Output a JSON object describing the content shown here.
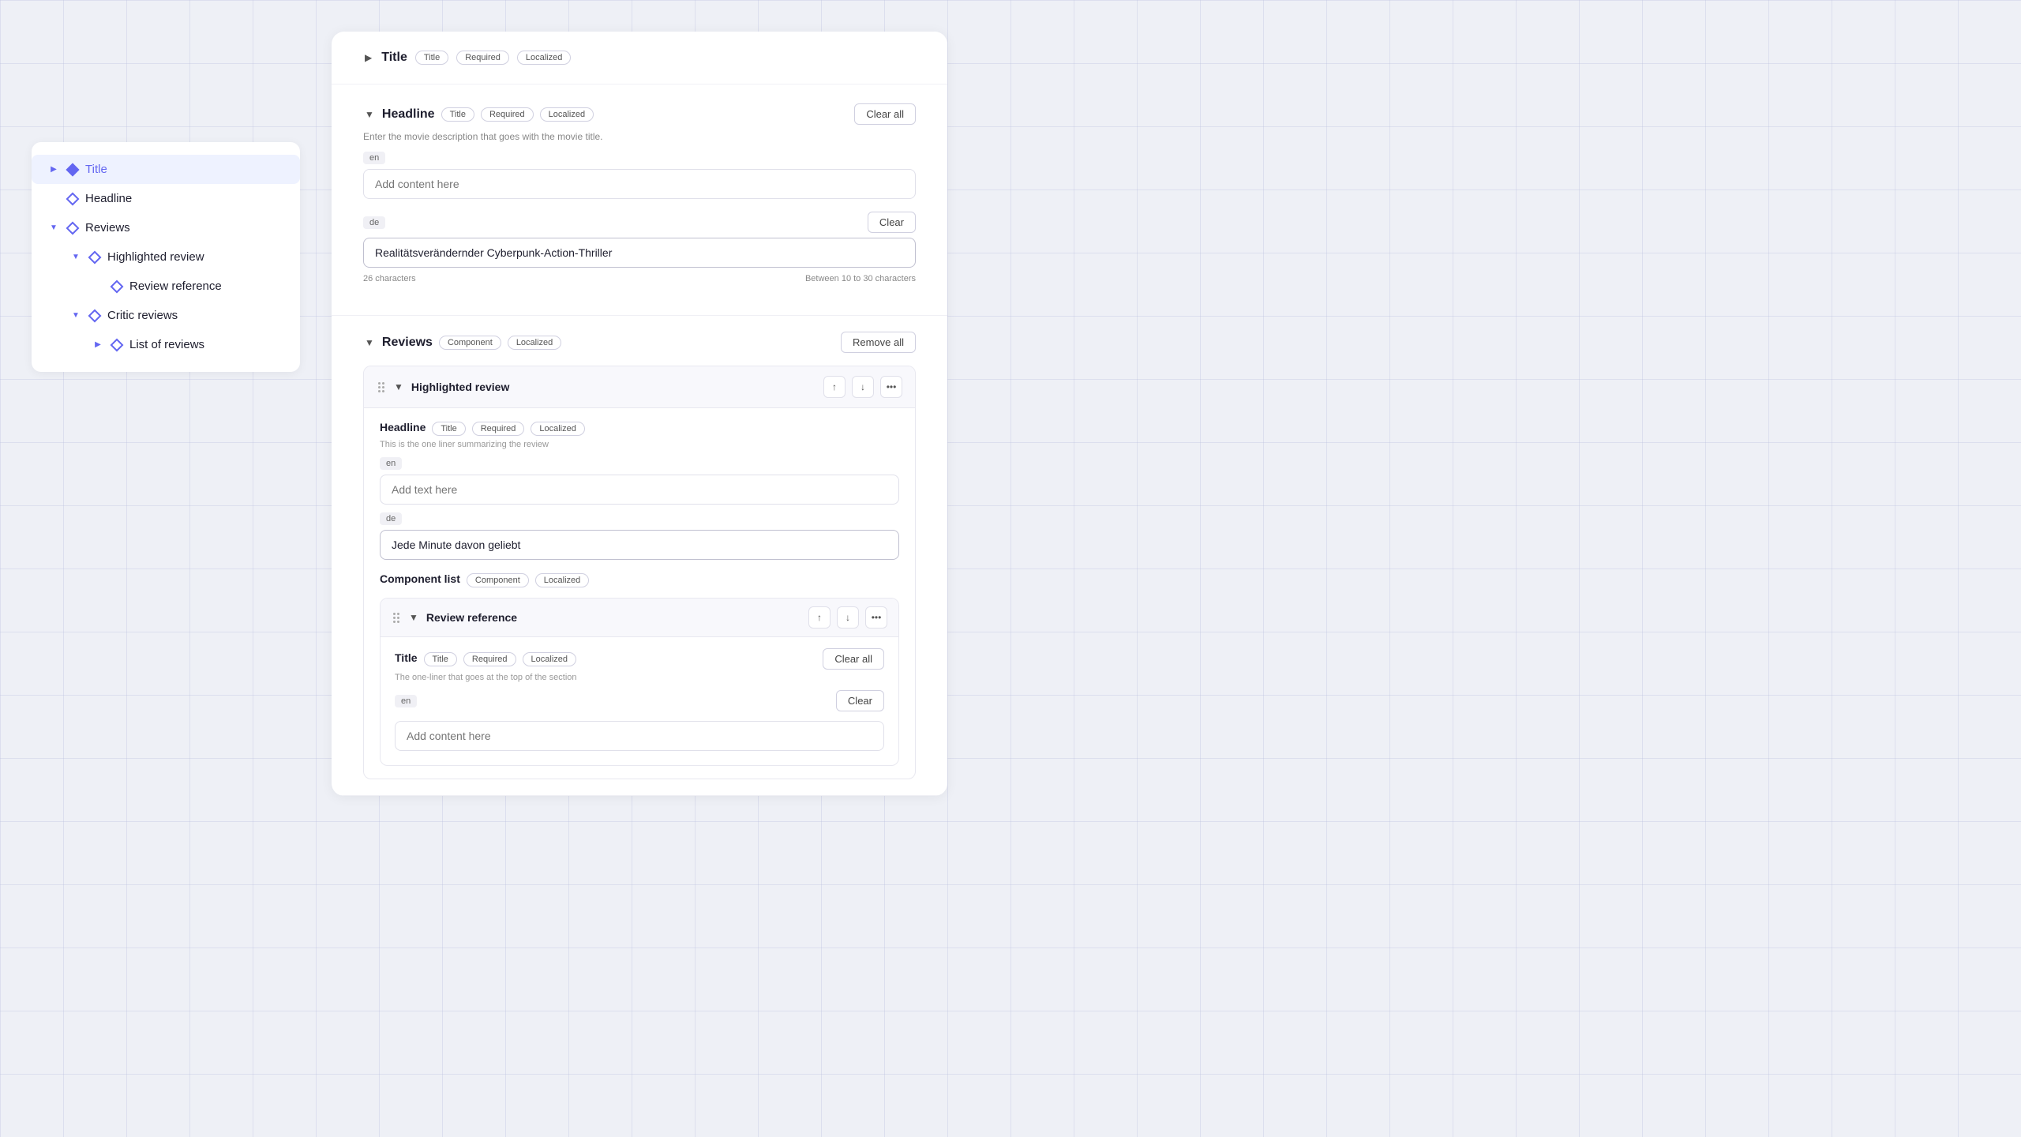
{
  "sidebar": {
    "items": [
      {
        "id": "title",
        "label": "Title",
        "indent": 0,
        "chevron": "right",
        "active": true,
        "diamond": "filled"
      },
      {
        "id": "headline",
        "label": "Headline",
        "indent": 0,
        "chevron": null,
        "active": false,
        "diamond": "outline"
      },
      {
        "id": "reviews",
        "label": "Reviews",
        "indent": 0,
        "chevron": "down",
        "active": false,
        "diamond": "outline"
      },
      {
        "id": "highlighted-review",
        "label": "Highlighted review",
        "indent": 1,
        "chevron": "down",
        "active": false,
        "diamond": "outline"
      },
      {
        "id": "review-reference",
        "label": "Review reference",
        "indent": 2,
        "chevron": null,
        "active": false,
        "diamond": "outline"
      },
      {
        "id": "critic-reviews",
        "label": "Critic reviews",
        "indent": 1,
        "chevron": "down",
        "active": false,
        "diamond": "outline"
      },
      {
        "id": "list-of-reviews",
        "label": "List of reviews",
        "indent": 2,
        "chevron": "right",
        "active": false,
        "diamond": "outline"
      }
    ]
  },
  "main": {
    "title_section": {
      "label": "Title",
      "tags": [
        "Title",
        "Required",
        "Localized"
      ],
      "chevron": "right"
    },
    "headline_section": {
      "label": "Headline",
      "tags": [
        "Title",
        "Required",
        "Localized"
      ],
      "clear_all_label": "Clear all",
      "hint": "Enter the movie description that goes with the movie title.",
      "fields": [
        {
          "lang": "en",
          "value": "",
          "placeholder": "Add content here",
          "has_clear": false
        },
        {
          "lang": "de",
          "value": "Realitätsverändernder Cyberpunk-Action-Thriller",
          "placeholder": "",
          "has_clear": true,
          "clear_label": "Clear",
          "char_count": "26 characters",
          "char_limit": "Between 10 to 30 characters"
        }
      ]
    },
    "reviews_section": {
      "label": "Reviews",
      "tags": [
        "Component",
        "Localized"
      ],
      "remove_all_label": "Remove all",
      "highlighted_review": {
        "label": "Highlighted review",
        "chevron": "down",
        "headline_field": {
          "label": "Headline",
          "tags": [
            "Title",
            "Required",
            "Localized"
          ],
          "hint": "This is the one liner summarizing the review",
          "fields": [
            {
              "lang": "en",
              "value": "",
              "placeholder": "Add text here"
            },
            {
              "lang": "de",
              "value": "Jede Minute davon geliebt"
            }
          ]
        },
        "component_list": {
          "label": "Component list",
          "tags": [
            "Component",
            "Localized"
          ],
          "review_reference": {
            "label": "Review reference",
            "chevron": "down",
            "title_field": {
              "label": "Title",
              "tags": [
                "Title",
                "Required",
                "Localized"
              ],
              "clear_all_label": "Clear all",
              "hint": "The one-liner that goes at the top of the section",
              "fields": [
                {
                  "lang": "en",
                  "value": "",
                  "placeholder": "Add content here",
                  "has_clear": true,
                  "clear_label": "Clear"
                }
              ]
            }
          }
        }
      }
    }
  }
}
